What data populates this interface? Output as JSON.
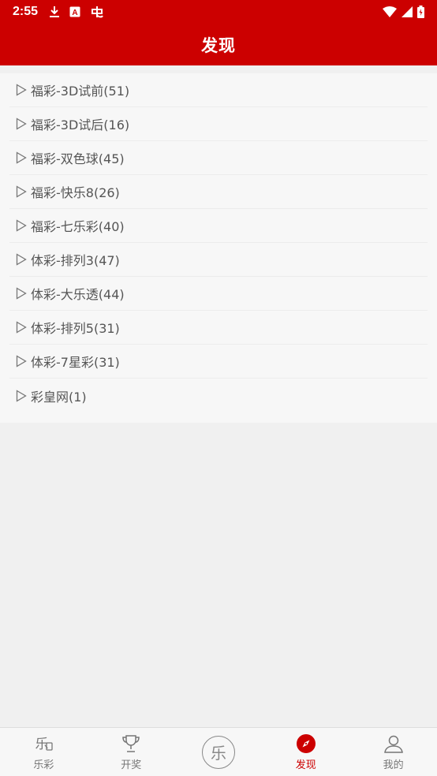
{
  "status_bar": {
    "time": "2:55",
    "left_icons": [
      "download-icon",
      "a-box-icon",
      "app-notification-icon"
    ],
    "right_icons": [
      "wifi-icon",
      "signal-icon",
      "battery-icon"
    ]
  },
  "header": {
    "title": "发现"
  },
  "list": {
    "items": [
      "福彩-3D试前(51)",
      "福彩-3D试后(16)",
      "福彩-双色球(45)",
      "福彩-快乐8(26)",
      "福彩-七乐彩(40)",
      "体彩-排列3(47)",
      "体彩-大乐透(44)",
      "体彩-排列5(31)",
      "体彩-7星彩(31)",
      "彩皇网(1)"
    ]
  },
  "tab_bar": {
    "tabs": [
      {
        "label": "乐彩",
        "icon": "lecai-icon"
      },
      {
        "label": "开奖",
        "icon": "trophy-icon"
      },
      {
        "label": "",
        "icon": "center-logo-icon",
        "glyph": "乐"
      },
      {
        "label": "发现",
        "icon": "compass-icon",
        "active": true
      },
      {
        "label": "我的",
        "icon": "user-icon"
      }
    ]
  },
  "colors": {
    "brand": "#cc0000",
    "text": "#555555",
    "tab_inactive": "#777777"
  }
}
